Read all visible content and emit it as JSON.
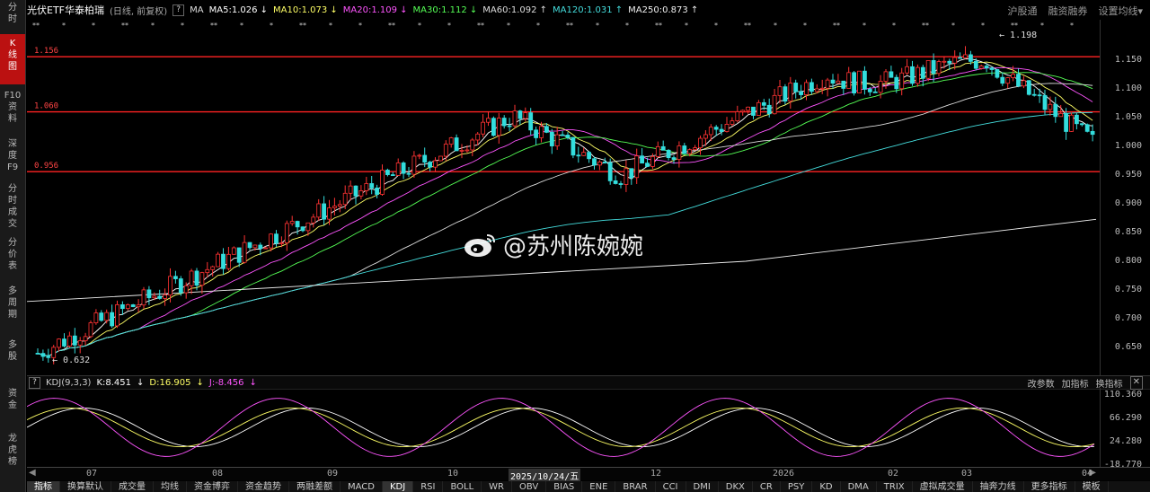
{
  "sidebar": [
    {
      "label": "分\n时",
      "active": false
    },
    {
      "label": "K\n线\n图",
      "active": true
    },
    {
      "label": "F10\n资\n料",
      "active": false
    },
    {
      "label": "深\n度\nF9",
      "active": false
    },
    {
      "label": "分\n时\n成\n交",
      "active": false
    },
    {
      "label": "分\n价\n表",
      "active": false
    },
    {
      "label": "多\n周\n期",
      "active": false
    },
    {
      "label": "多\n股",
      "active": false
    },
    {
      "label": "资\n金",
      "active": false
    },
    {
      "label": "龙\n虎\n榜",
      "active": false
    }
  ],
  "header": {
    "title": "光伏ETF华泰柏瑞",
    "mode": "(日线, 前复权)",
    "help": "?",
    "ma_label": "MA",
    "ma_items": [
      {
        "text": "MA5:1.026",
        "arrow": "↓",
        "color": "#ffffff"
      },
      {
        "text": "MA10:1.073",
        "arrow": "↓",
        "color": "#ffff66"
      },
      {
        "text": "MA20:1.109",
        "arrow": "↓",
        "color": "#ff55ff"
      },
      {
        "text": "MA30:1.112",
        "arrow": "↓",
        "color": "#55ff55"
      },
      {
        "text": "MA60:1.092",
        "arrow": "↑",
        "color": "#dddddd"
      },
      {
        "text": "MA120:1.031",
        "arrow": "↑",
        "color": "#44dddd"
      },
      {
        "text": "MA250:0.873",
        "arrow": "↑",
        "color": "#eeeeee"
      }
    ],
    "right": [
      "沪股通",
      "融资融券",
      "设置均线▾"
    ]
  },
  "levels": [
    {
      "label": "1.156",
      "value": 1.156
    },
    {
      "label": "1.060",
      "value": 1.06
    },
    {
      "label": "0.956",
      "value": 0.956
    }
  ],
  "price_axis": [
    "1.150",
    "1.100",
    "1.050",
    "1.000",
    "0.950",
    "0.900",
    "0.850",
    "0.800",
    "0.750",
    "0.700",
    "0.650"
  ],
  "annotations": {
    "high": "1.198",
    "low": "0.632"
  },
  "kdj": {
    "help": "?",
    "name": "KDJ(9,3,3)",
    "k": "K:8.451",
    "d": "D:16.905",
    "j": "J:-8.456",
    "right": [
      "改参数",
      "加指标",
      "换指标"
    ],
    "close": "✕",
    "axis": [
      "110.360",
      "66.290",
      "24.280",
      "-18.770"
    ]
  },
  "xaxis": [
    "07",
    "08",
    "09",
    "10",
    "2025/10/24/五",
    "12",
    "2026",
    "02",
    "03",
    "04"
  ],
  "tabs": [
    "指标",
    "换算默认",
    "成交量",
    "均线",
    "资金博弈",
    "资金趋势",
    "两融差额",
    "MACD",
    "KDJ",
    "RSI",
    "BOLL",
    "WR",
    "OBV",
    "BIAS",
    "ENE",
    "BRAR",
    "CCI",
    "DMI",
    "DKX",
    "CR",
    "PSY",
    "KD",
    "DMA",
    "TRIX",
    "虚拟成交量",
    "抽奔力线",
    "更多指标",
    "模板"
  ],
  "active_tab": "KDJ",
  "watermark": "@苏州陈婉婉",
  "colors": {
    "up": "#ff3333",
    "down": "#33dddd",
    "level": "#ff2222"
  }
}
